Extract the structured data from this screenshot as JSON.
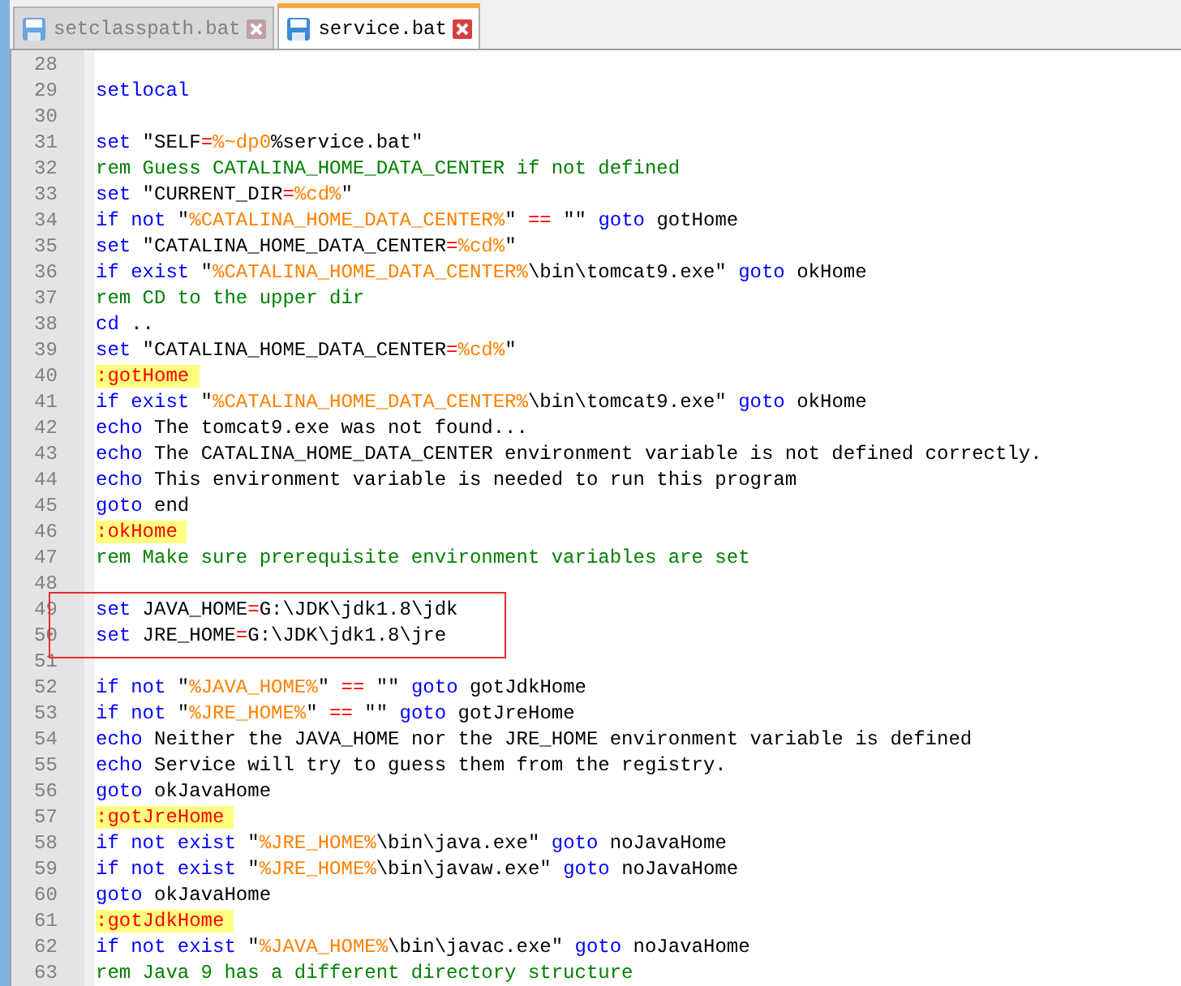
{
  "tabs": [
    {
      "label": "setclasspath.bat",
      "selected": false
    },
    {
      "label": "service.bat",
      "selected": true
    }
  ],
  "editor": {
    "lines": [
      {
        "number": "28"
      },
      {
        "number": "29",
        "tokens": [
          {
            "kind": "keyword",
            "text": "setlocal"
          }
        ]
      },
      {
        "number": "30"
      },
      {
        "number": "31",
        "tokens": [
          {
            "kind": "keyword",
            "text": "set"
          },
          {
            "kind": "text",
            "text": " \"SELF"
          },
          {
            "kind": "operator",
            "text": "="
          },
          {
            "kind": "variable",
            "text": "%~dp0"
          },
          {
            "kind": "text",
            "text": "%service.bat\""
          }
        ]
      },
      {
        "number": "32",
        "tokens": [
          {
            "kind": "comment",
            "text": "rem Guess CATALINA_HOME_DATA_CENTER if not defined"
          }
        ]
      },
      {
        "number": "33",
        "tokens": [
          {
            "kind": "keyword",
            "text": "set"
          },
          {
            "kind": "text",
            "text": " \"CURRENT_DIR"
          },
          {
            "kind": "operator",
            "text": "="
          },
          {
            "kind": "variable",
            "text": "%cd%"
          },
          {
            "kind": "text",
            "text": "\""
          }
        ]
      },
      {
        "number": "34",
        "tokens": [
          {
            "kind": "keyword",
            "text": "if not"
          },
          {
            "kind": "text",
            "text": " \""
          },
          {
            "kind": "variable",
            "text": "%CATALINA_HOME_DATA_CENTER%"
          },
          {
            "kind": "text",
            "text": "\" "
          },
          {
            "kind": "operator",
            "text": "=="
          },
          {
            "kind": "text",
            "text": " \"\" "
          },
          {
            "kind": "keyword",
            "text": "goto"
          },
          {
            "kind": "text",
            "text": " gotHome"
          }
        ]
      },
      {
        "number": "35",
        "tokens": [
          {
            "kind": "keyword",
            "text": "set"
          },
          {
            "kind": "text",
            "text": " \"CATALINA_HOME_DATA_CENTER"
          },
          {
            "kind": "operator",
            "text": "="
          },
          {
            "kind": "variable",
            "text": "%cd%"
          },
          {
            "kind": "text",
            "text": "\""
          }
        ]
      },
      {
        "number": "36",
        "tokens": [
          {
            "kind": "keyword",
            "text": "if exist"
          },
          {
            "kind": "text",
            "text": " \""
          },
          {
            "kind": "variable",
            "text": "%CATALINA_HOME_DATA_CENTER%"
          },
          {
            "kind": "text",
            "text": "\\bin\\tomcat9.exe\" "
          },
          {
            "kind": "keyword",
            "text": "goto"
          },
          {
            "kind": "text",
            "text": " okHome"
          }
        ]
      },
      {
        "number": "37",
        "tokens": [
          {
            "kind": "comment",
            "text": "rem CD to the upper dir"
          }
        ]
      },
      {
        "number": "38",
        "tokens": [
          {
            "kind": "keyword",
            "text": "cd"
          },
          {
            "kind": "text",
            "text": " .."
          }
        ]
      },
      {
        "number": "39",
        "tokens": [
          {
            "kind": "keyword",
            "text": "set"
          },
          {
            "kind": "text",
            "text": " \"CATALINA_HOME_DATA_CENTER"
          },
          {
            "kind": "operator",
            "text": "="
          },
          {
            "kind": "variable",
            "text": "%cd%"
          },
          {
            "kind": "text",
            "text": "\""
          }
        ]
      },
      {
        "number": "40",
        "tokens": [
          {
            "kind": "label",
            "text": ":gotHome"
          }
        ]
      },
      {
        "number": "41",
        "tokens": [
          {
            "kind": "keyword",
            "text": "if exist"
          },
          {
            "kind": "text",
            "text": " \""
          },
          {
            "kind": "variable",
            "text": "%CATALINA_HOME_DATA_CENTER%"
          },
          {
            "kind": "text",
            "text": "\\bin\\tomcat9.exe\" "
          },
          {
            "kind": "keyword",
            "text": "goto"
          },
          {
            "kind": "text",
            "text": " okHome"
          }
        ]
      },
      {
        "number": "42",
        "tokens": [
          {
            "kind": "keyword",
            "text": "echo"
          },
          {
            "kind": "text",
            "text": " The tomcat9.exe was not found..."
          }
        ]
      },
      {
        "number": "43",
        "tokens": [
          {
            "kind": "keyword",
            "text": "echo"
          },
          {
            "kind": "text",
            "text": " The CATALINA_HOME_DATA_CENTER environment variable is not defined correctly."
          }
        ]
      },
      {
        "number": "44",
        "tokens": [
          {
            "kind": "keyword",
            "text": "echo"
          },
          {
            "kind": "text",
            "text": " This environment variable is needed to run this program"
          }
        ]
      },
      {
        "number": "45",
        "tokens": [
          {
            "kind": "keyword",
            "text": "goto"
          },
          {
            "kind": "text",
            "text": " end"
          }
        ]
      },
      {
        "number": "46",
        "tokens": [
          {
            "kind": "label",
            "text": ":okHome"
          }
        ]
      },
      {
        "number": "47",
        "tokens": [
          {
            "kind": "comment",
            "text": "rem Make sure prerequisite environment variables are set"
          }
        ]
      },
      {
        "number": "48"
      },
      {
        "number": "49",
        "tokens": [
          {
            "kind": "keyword",
            "text": "set"
          },
          {
            "kind": "text",
            "text": " JAVA_HOME"
          },
          {
            "kind": "operator",
            "text": "="
          },
          {
            "kind": "text",
            "text": "G:\\JDK\\jdk1.8\\jdk"
          }
        ]
      },
      {
        "number": "50",
        "tokens": [
          {
            "kind": "keyword",
            "text": "set"
          },
          {
            "kind": "text",
            "text": " JRE_HOME"
          },
          {
            "kind": "operator",
            "text": "="
          },
          {
            "kind": "text",
            "text": "G:\\JDK\\jdk1.8\\jre"
          }
        ]
      },
      {
        "number": "51"
      },
      {
        "number": "52",
        "tokens": [
          {
            "kind": "keyword",
            "text": "if not"
          },
          {
            "kind": "text",
            "text": " \""
          },
          {
            "kind": "variable",
            "text": "%JAVA_HOME%"
          },
          {
            "kind": "text",
            "text": "\" "
          },
          {
            "kind": "operator",
            "text": "=="
          },
          {
            "kind": "text",
            "text": " \"\" "
          },
          {
            "kind": "keyword",
            "text": "goto"
          },
          {
            "kind": "text",
            "text": " gotJdkHome"
          }
        ]
      },
      {
        "number": "53",
        "tokens": [
          {
            "kind": "keyword",
            "text": "if not"
          },
          {
            "kind": "text",
            "text": " \""
          },
          {
            "kind": "variable",
            "text": "%JRE_HOME%"
          },
          {
            "kind": "text",
            "text": "\" "
          },
          {
            "kind": "operator",
            "text": "=="
          },
          {
            "kind": "text",
            "text": " \"\" "
          },
          {
            "kind": "keyword",
            "text": "goto"
          },
          {
            "kind": "text",
            "text": " gotJreHome"
          }
        ]
      },
      {
        "number": "54",
        "tokens": [
          {
            "kind": "keyword",
            "text": "echo"
          },
          {
            "kind": "text",
            "text": " Neither the JAVA_HOME nor the JRE_HOME environment variable is defined"
          }
        ]
      },
      {
        "number": "55",
        "tokens": [
          {
            "kind": "keyword",
            "text": "echo"
          },
          {
            "kind": "text",
            "text": " Service will try to guess them from the registry."
          }
        ]
      },
      {
        "number": "56",
        "tokens": [
          {
            "kind": "keyword",
            "text": "goto"
          },
          {
            "kind": "text",
            "text": " okJavaHome"
          }
        ]
      },
      {
        "number": "57",
        "tokens": [
          {
            "kind": "label",
            "text": ":gotJreHome"
          }
        ]
      },
      {
        "number": "58",
        "tokens": [
          {
            "kind": "keyword",
            "text": "if not exist"
          },
          {
            "kind": "text",
            "text": " \""
          },
          {
            "kind": "variable",
            "text": "%JRE_HOME%"
          },
          {
            "kind": "text",
            "text": "\\bin\\java.exe\" "
          },
          {
            "kind": "keyword",
            "text": "goto"
          },
          {
            "kind": "text",
            "text": " noJavaHome"
          }
        ]
      },
      {
        "number": "59",
        "tokens": [
          {
            "kind": "keyword",
            "text": "if not exist"
          },
          {
            "kind": "text",
            "text": " \""
          },
          {
            "kind": "variable",
            "text": "%JRE_HOME%"
          },
          {
            "kind": "text",
            "text": "\\bin\\javaw.exe\" "
          },
          {
            "kind": "keyword",
            "text": "goto"
          },
          {
            "kind": "text",
            "text": " noJavaHome"
          }
        ]
      },
      {
        "number": "60",
        "tokens": [
          {
            "kind": "keyword",
            "text": "goto"
          },
          {
            "kind": "text",
            "text": " okJavaHome"
          }
        ]
      },
      {
        "number": "61",
        "tokens": [
          {
            "kind": "label",
            "text": ":gotJdkHome"
          }
        ]
      },
      {
        "number": "62",
        "tokens": [
          {
            "kind": "keyword",
            "text": "if not exist"
          },
          {
            "kind": "text",
            "text": " \""
          },
          {
            "kind": "variable",
            "text": "%JAVA_HOME%"
          },
          {
            "kind": "text",
            "text": "\\bin\\javac.exe\" "
          },
          {
            "kind": "keyword",
            "text": "goto"
          },
          {
            "kind": "text",
            "text": " noJavaHome"
          }
        ]
      },
      {
        "number": "63",
        "tokens": [
          {
            "kind": "comment",
            "text": "rem Java 9 has a different directory structure"
          }
        ]
      }
    ]
  }
}
